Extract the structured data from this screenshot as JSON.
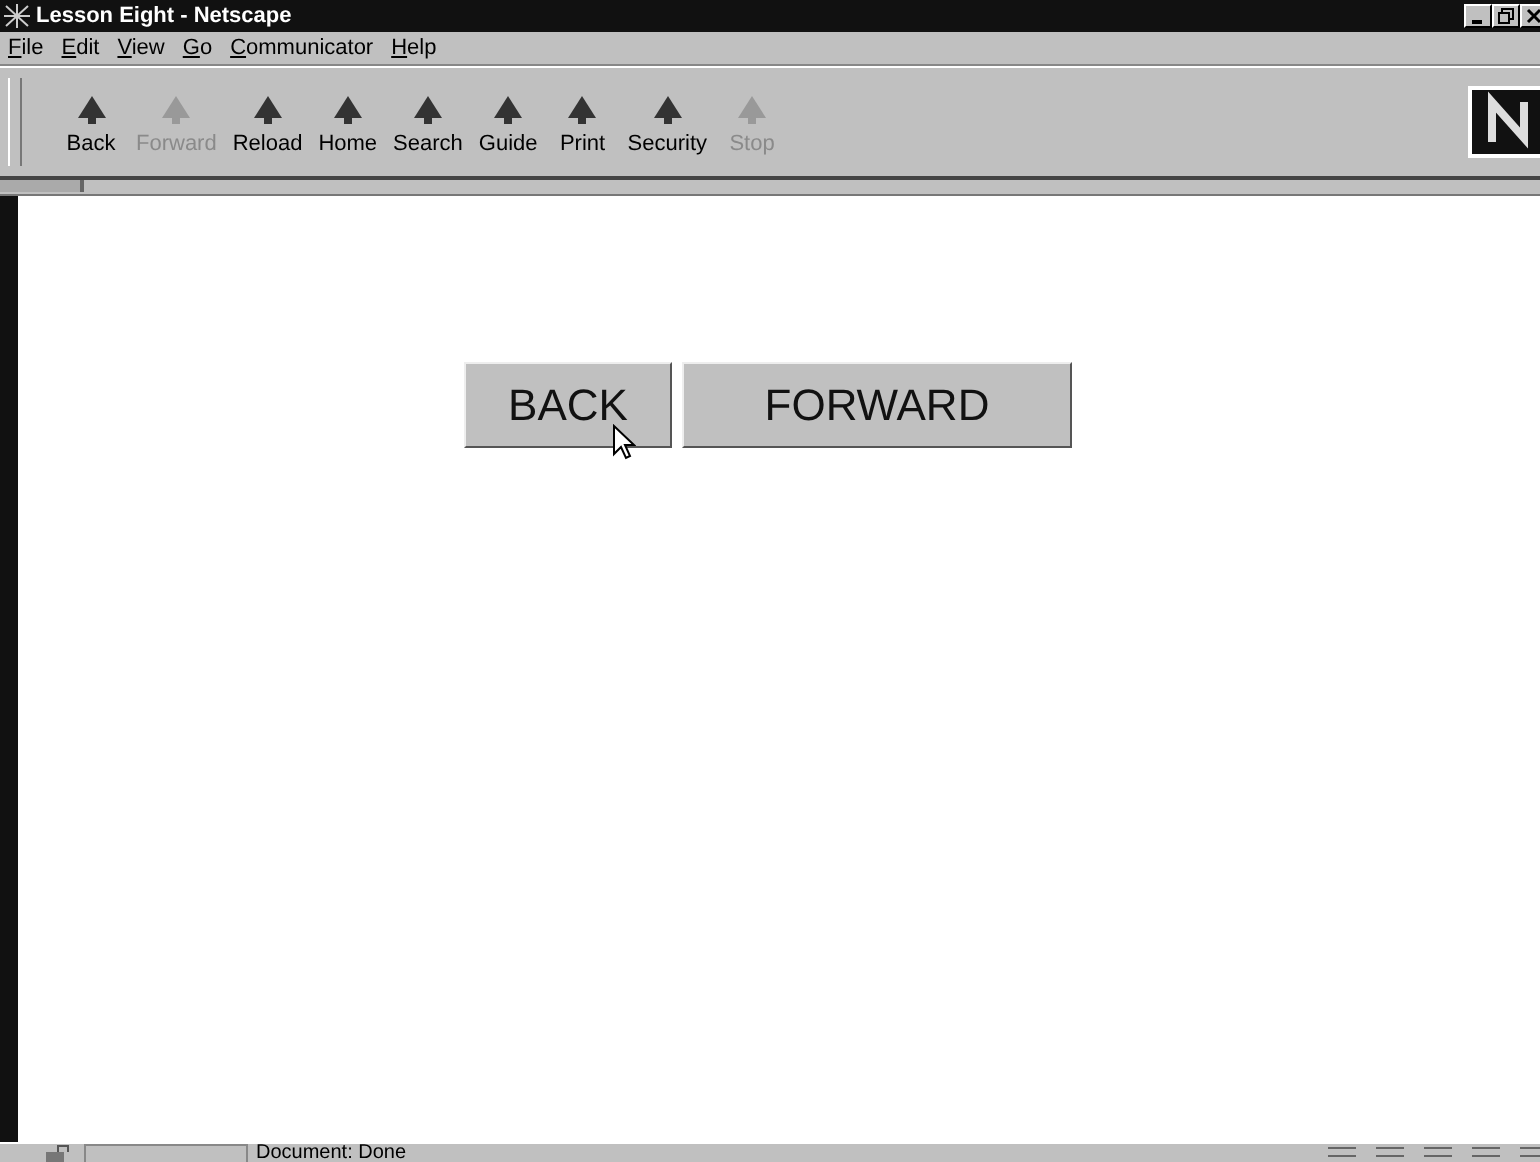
{
  "window": {
    "title": "Lesson Eight - Netscape"
  },
  "menu": [
    "File",
    "Edit",
    "View",
    "Go",
    "Communicator",
    "Help"
  ],
  "toolbar": [
    {
      "label": "Back",
      "disabled": false
    },
    {
      "label": "Forward",
      "disabled": true
    },
    {
      "label": "Reload",
      "disabled": false
    },
    {
      "label": "Home",
      "disabled": false
    },
    {
      "label": "Search",
      "disabled": false
    },
    {
      "label": "Guide",
      "disabled": false
    },
    {
      "label": "Print",
      "disabled": false
    },
    {
      "label": "Security",
      "disabled": false
    },
    {
      "label": "Stop",
      "disabled": true
    }
  ],
  "page": {
    "buttons": [
      "BACK",
      "FORWARD"
    ]
  },
  "status_bar": {
    "text": "Document: Done"
  }
}
